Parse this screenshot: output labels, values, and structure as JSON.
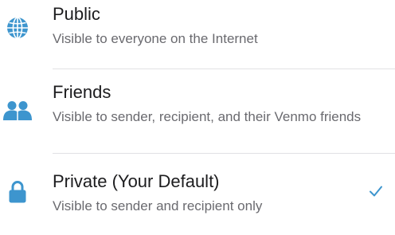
{
  "colors": {
    "accent": "#3d95ce",
    "title_text": "#1c1c1e",
    "description_text": "#6a6a6f",
    "divider": "#e1e1e4"
  },
  "options": [
    {
      "icon": "globe-icon",
      "title": "Public",
      "description": "Visible to everyone on the Internet",
      "selected": false
    },
    {
      "icon": "friends-icon",
      "title": "Friends",
      "description": "Visible to sender, recipient, and their Venmo friends",
      "selected": false
    },
    {
      "icon": "lock-icon",
      "title": "Private (Your Default)",
      "description": "Visible to sender and recipient only",
      "selected": true
    }
  ]
}
